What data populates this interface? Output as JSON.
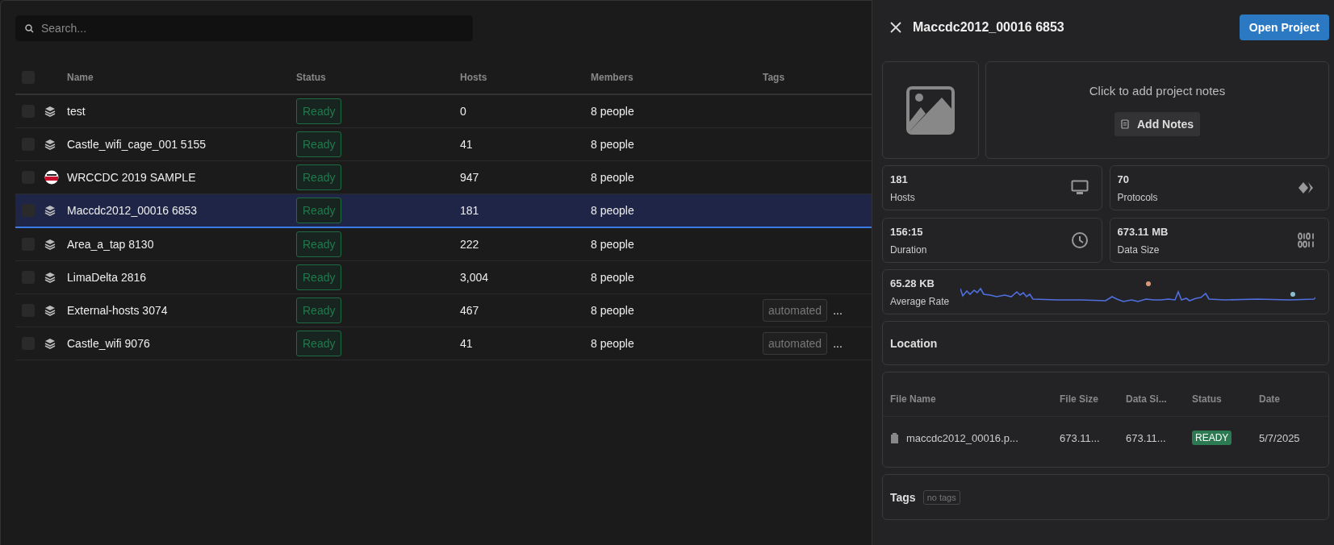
{
  "search": {
    "placeholder": "Search..."
  },
  "table": {
    "select_all_checked": false,
    "columns": [
      "Name",
      "Status",
      "Hosts",
      "Members",
      "Tags"
    ],
    "rows": [
      {
        "kind": "layers",
        "name": "test",
        "status": "Ready",
        "hosts": "0",
        "members": "8 people",
        "selected": false,
        "checked": false
      },
      {
        "kind": "layers",
        "name": "Castle_wifi_cage_001 5155",
        "status": "Ready",
        "hosts": "41",
        "members": "8 people",
        "selected": false,
        "checked": false
      },
      {
        "kind": "logo",
        "name": "WRCCDC 2019 SAMPLE",
        "status": "Ready",
        "hosts": "947",
        "members": "8 people",
        "selected": false,
        "checked": false
      },
      {
        "kind": "layers",
        "name": "Maccdc2012_00016 6853",
        "status": "Ready",
        "hosts": "181",
        "members": "8 people",
        "selected": true,
        "checked": false
      },
      {
        "kind": "layers",
        "name": "Area_a_tap 8130",
        "status": "Ready",
        "hosts": "222",
        "members": "8 people",
        "selected": false,
        "checked": false
      },
      {
        "kind": "layers",
        "name": "LimaDelta 2816",
        "status": "Ready",
        "hosts": "3,004",
        "members": "8 people",
        "selected": false,
        "checked": false
      },
      {
        "kind": "layers",
        "name": "External-hosts 3074",
        "status": "Ready",
        "hosts": "467",
        "members": "8 people",
        "tags": [
          "automated"
        ],
        "tags_more": "...",
        "selected": false,
        "checked": false
      },
      {
        "kind": "layers",
        "name": "Castle_wifi 9076",
        "status": "Ready",
        "hosts": "41",
        "members": "8 people",
        "tags": [
          "automated"
        ],
        "tags_more": "...",
        "selected": false,
        "checked": false
      }
    ]
  },
  "panel": {
    "title": "Maccdc2012_00016 6853",
    "open_button": "Open Project",
    "notes": {
      "prompt": "Click to add project notes",
      "button": "Add Notes"
    },
    "stats": [
      {
        "kind": "hosts",
        "value": "181",
        "label": "Hosts"
      },
      {
        "kind": "protocols",
        "value": "70",
        "label": "Protocols"
      },
      {
        "kind": "duration",
        "value": "156:15",
        "label": "Duration"
      },
      {
        "kind": "size",
        "value": "673.11 MB",
        "label": "Data Size"
      }
    ],
    "rate": {
      "value": "65.28 KB",
      "label": "Average Rate"
    },
    "location": {
      "title": "Location"
    },
    "files": {
      "columns": [
        "File Name",
        "File Size",
        "Data Si...",
        "Status",
        "Date"
      ],
      "rows": [
        {
          "name": "maccdc2012_00016.p...",
          "file_size": "673.11...",
          "data_size": "673.11...",
          "status": "READY",
          "date": "5/7/2025"
        }
      ]
    },
    "tags": {
      "title": "Tags",
      "empty": "no tags"
    }
  }
}
